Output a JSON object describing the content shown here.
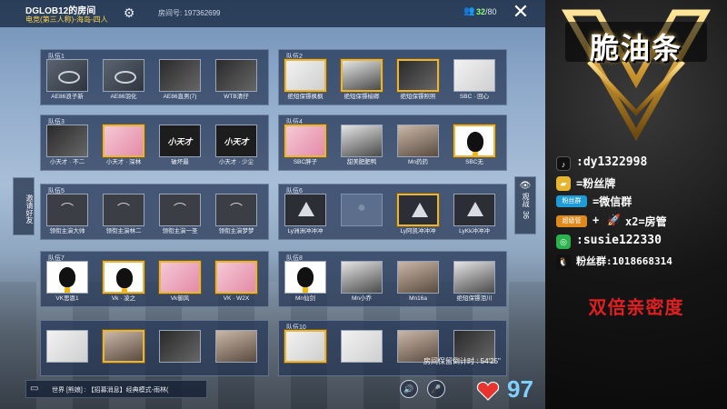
{
  "topbar": {
    "room_title": "DGLOB12的房间",
    "room_mode": "电竞(第三人称)-海岛-四人",
    "room_number_label": "房间号: 197362699",
    "count_online": "32",
    "count_total": "/80"
  },
  "teams": [
    {
      "label": "队伍1",
      "slots": [
        {
          "name": "AE86浪子新",
          "style": "logo",
          "gold": false
        },
        {
          "name": "AE86羽化",
          "style": "logo",
          "gold": false
        },
        {
          "name": "AE86直男(7)",
          "style": "dark",
          "gold": false
        },
        {
          "name": "WTB清仔",
          "style": "dark",
          "gold": false
        }
      ]
    },
    {
      "label": "队伍2",
      "slots": [
        {
          "name": "绝短保镖枫枫",
          "style": "white",
          "gold": true
        },
        {
          "name": "绝短保镖榆卿",
          "style": "bw",
          "gold": true
        },
        {
          "name": "绝短保镖照照",
          "style": "dark",
          "gold": true
        },
        {
          "name": "SBC · 回心",
          "style": "white",
          "gold": false
        }
      ]
    },
    {
      "label": "队伍3",
      "slots": [
        {
          "name": "小天才 · 不二",
          "style": "dark",
          "gold": false
        },
        {
          "name": "小天才 · 深林",
          "style": "anime",
          "gold": true
        },
        {
          "name": "破坏最",
          "style": "text",
          "gold": false,
          "text": "小天才"
        },
        {
          "name": "小天才 · 少尘",
          "style": "text",
          "gold": false,
          "text": "小天才"
        }
      ]
    },
    {
      "label": "队伍4",
      "slots": [
        {
          "name": "SBC胖子",
          "style": "anime",
          "gold": true
        },
        {
          "name": "甜美肥肥鸭",
          "style": "bw",
          "gold": false
        },
        {
          "name": "Mn药药",
          "style": "photo",
          "gold": false
        },
        {
          "name": "SBC无",
          "style": "penguin",
          "gold": true
        }
      ]
    },
    {
      "label": "队伍5",
      "slots": [
        {
          "name": "领衔主演大帅",
          "style": "brand",
          "gold": false
        },
        {
          "name": "领衔主演林二",
          "style": "brand",
          "gold": false
        },
        {
          "name": "领衔主演一圣",
          "style": "brand",
          "gold": false
        },
        {
          "name": "领衔主演梦梦",
          "style": "brand",
          "gold": false
        }
      ]
    },
    {
      "label": "队伍6",
      "slots": [
        {
          "name": "Ly洲洲冲冲冲",
          "style": "tri",
          "gold": false
        },
        {
          "name": "",
          "style": "person",
          "gold": false,
          "empty": true
        },
        {
          "name": "Ly阿凯冲冲冲",
          "style": "tri",
          "gold": true
        },
        {
          "name": "LyKk冲冲冲",
          "style": "tri",
          "gold": false
        }
      ]
    },
    {
      "label": "队伍7",
      "slots": [
        {
          "name": "VK思恩1",
          "style": "penguin",
          "gold": false
        },
        {
          "name": "Vk · 凌之",
          "style": "penguin",
          "gold": true
        },
        {
          "name": "Vk御风",
          "style": "anime",
          "gold": true
        },
        {
          "name": "VK · W2X",
          "style": "anime",
          "gold": true
        }
      ]
    },
    {
      "label": "队伍8",
      "slots": [
        {
          "name": "Mn仙剑",
          "style": "penguin",
          "gold": false
        },
        {
          "name": "Mn小乔",
          "style": "bw",
          "gold": false
        },
        {
          "name": "Mn16a",
          "style": "photo",
          "gold": false
        },
        {
          "name": "绝短保镖泪川",
          "style": "bw",
          "gold": false
        }
      ]
    },
    {
      "label": "",
      "slots": [
        {
          "name": "",
          "style": "white",
          "gold": false
        },
        {
          "name": "",
          "style": "photo",
          "gold": true
        },
        {
          "name": "",
          "style": "dark",
          "gold": false
        },
        {
          "name": "",
          "style": "photo",
          "gold": false
        }
      ]
    },
    {
      "label": "队伍10",
      "slots": [
        {
          "name": "",
          "style": "white",
          "gold": true
        },
        {
          "name": "",
          "style": "white",
          "gold": false
        },
        {
          "name": "",
          "style": "photo",
          "gold": false
        },
        {
          "name": "",
          "style": "dark",
          "gold": false
        }
      ]
    }
  ],
  "side": {
    "invite": "邀请好友",
    "watch": "观战",
    "watch_count": "36"
  },
  "bottom": {
    "timer": "房间保留倒计时 : 54'25\"",
    "chat": "世界 [熊娘] : 【招募消息】经典模式-雨林(",
    "heart_count": "97"
  },
  "panel": {
    "logo_text": "脆油条",
    "tiktok": ":dy1322998",
    "fans_badge": "=粉丝牌",
    "wechat_group_badge": "粉丝群",
    "wechat_group": "=微信群",
    "manager_badge": "超级管",
    "manager_text": "x2=房管",
    "wechat_id": ":susie122330",
    "fans_group": "粉丝群:1018668314",
    "double": "双倍亲密度"
  },
  "colors": {
    "gold": "#e0b64a",
    "accent_blue": "#7fd0ff",
    "red": "#e02020",
    "yellow": "#ffd54a"
  }
}
